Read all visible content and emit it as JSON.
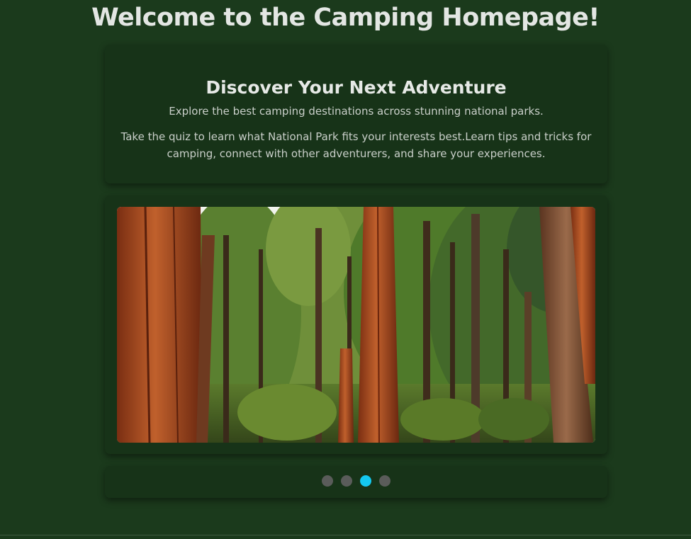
{
  "page": {
    "title": "Welcome to the Camping Homepage!"
  },
  "intro": {
    "heading": "Discover Your Next Adventure",
    "subheading": "Explore the best camping destinations across stunning national parks.",
    "body": "Take the quiz to learn what National Park fits your interests best.Learn tips and tricks for camping, connect with other adventurers, and share your experiences."
  },
  "carousel": {
    "active_index": 2,
    "dots": [
      {
        "state": "inactive"
      },
      {
        "state": "inactive"
      },
      {
        "state": "active"
      },
      {
        "state": "inactive"
      }
    ]
  },
  "colors": {
    "background": "#1b3a1c",
    "card": "#173318",
    "dot_inactive": "#5a5c5a",
    "dot_active": "#14c8f0"
  }
}
